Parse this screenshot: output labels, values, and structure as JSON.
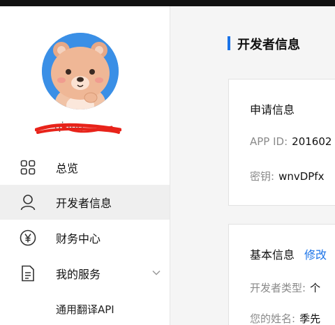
{
  "sidebar": {
    "username": "qiang",
    "items": [
      {
        "label": "总览",
        "icon": "grid-icon"
      },
      {
        "label": "开发者信息",
        "icon": "user-icon"
      },
      {
        "label": "财务中心",
        "icon": "yen-icon"
      },
      {
        "label": "我的服务",
        "icon": "document-icon"
      }
    ],
    "subitems": [
      {
        "label": "通用翻译API"
      }
    ],
    "active_index": 1
  },
  "main": {
    "title": "开发者信息",
    "apply_card": {
      "title": "申请信息",
      "app_id_label": "APP ID:",
      "app_id_value": "201602",
      "secret_label": "密钥:",
      "secret_value": "wnvDPfx"
    },
    "basic_card": {
      "title": "基本信息",
      "edit_label": "修改",
      "dev_type_label": "开发者类型:",
      "dev_type_value": "个",
      "name_label": "您的姓名:",
      "name_value": "季先"
    }
  },
  "colors": {
    "accent": "#1a73e8",
    "avatar_bg": "#3a8fe6",
    "active_bg": "#efefef",
    "redaction": "#e8231a"
  }
}
